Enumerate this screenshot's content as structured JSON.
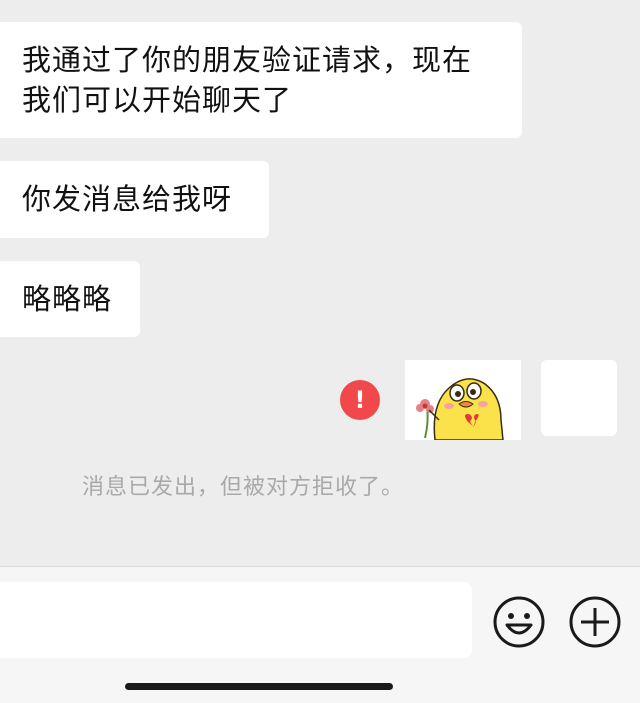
{
  "messages": [
    {
      "text": "我通过了你的朋友验证请求，现在\n我们可以开始聊天了"
    },
    {
      "text": "你发消息给我呀"
    },
    {
      "text": "略略略"
    }
  ],
  "sent_message": {
    "status_icon": "exclamation-icon",
    "status_symbol": "!",
    "sticker": "yellow-chick-sticker",
    "status_color": "#f0484b"
  },
  "system_note": "消息已发出，但被对方拒收了。",
  "input_bar": {
    "input_value": "",
    "emoji_icon": "emoji-icon",
    "plus_icon": "plus-icon"
  }
}
